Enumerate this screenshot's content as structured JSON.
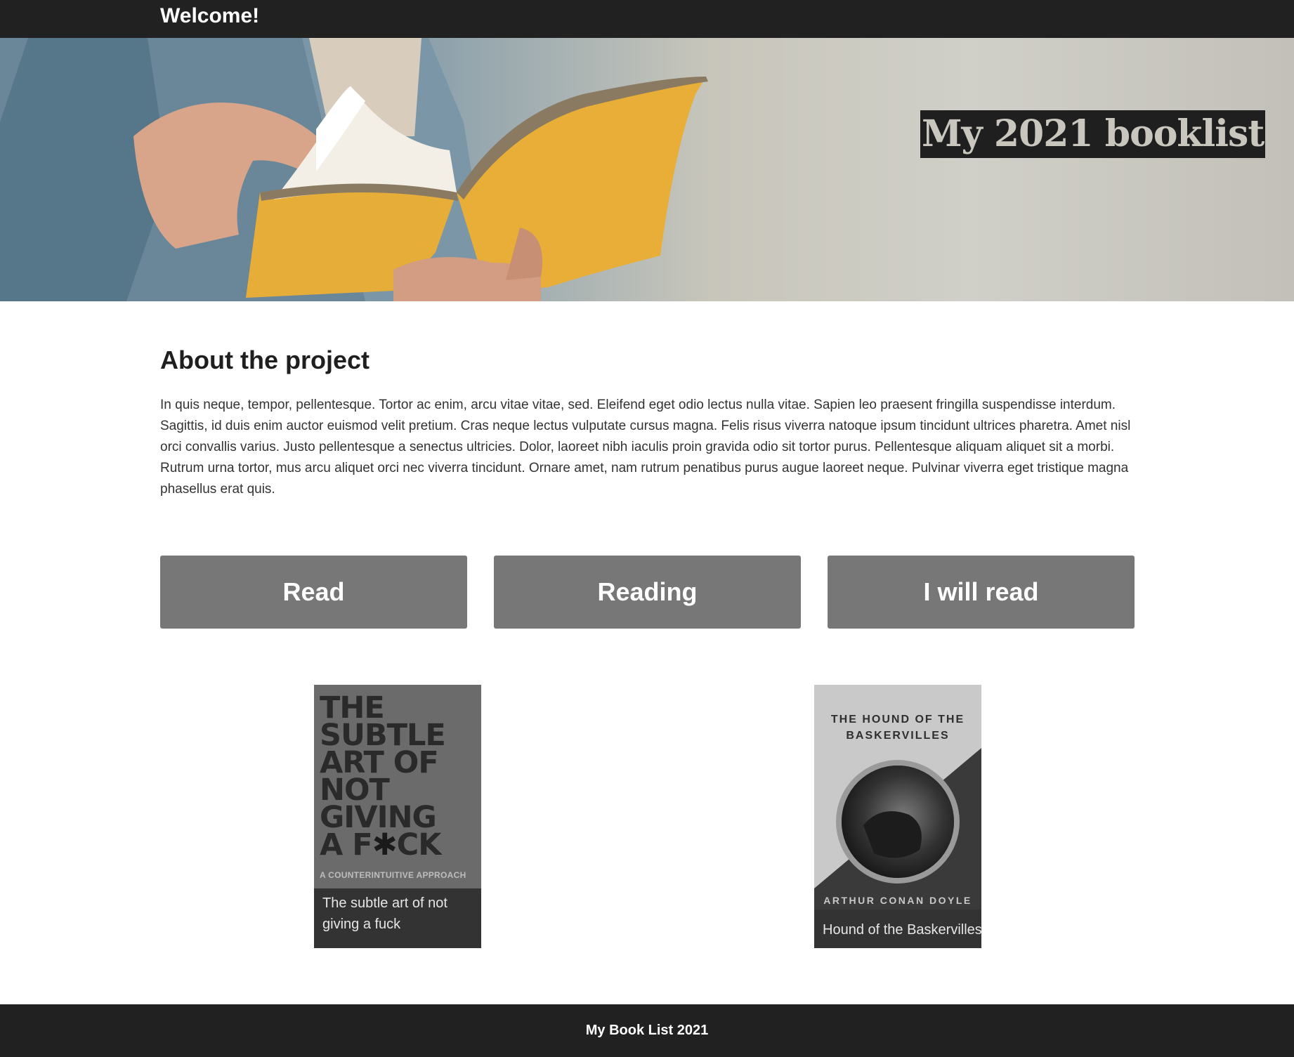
{
  "header": {
    "welcome": "Welcome!"
  },
  "hero": {
    "title": "My 2021 booklist"
  },
  "about": {
    "heading": "About the project",
    "body": "In quis neque, tempor, pellentesque. Tortor ac enim, arcu vitae vitae, sed. Eleifend eget odio lectus nulla vitae. Sapien leo praesent fringilla suspendisse interdum. Sagittis, id duis enim auctor euismod velit pretium. Cras neque lectus vulputate cursus magna. Felis risus viverra natoque ipsum tincidunt ultrices pharetra. Amet nisl orci convallis varius. Justo pellentesque a senectus ultricies. Dolor, laoreet nibh iaculis proin gravida odio sit tortor purus. Pellentesque aliquam aliquet sit a morbi. Rutrum urna tortor, mus arcu aliquet orci nec viverra tincidunt. Ornare amet, nam rutrum penatibus purus augue laoreet neque. Pulvinar viverra eget tristique magna phasellus erat quis."
  },
  "tabs": [
    {
      "label": "Read"
    },
    {
      "label": "Reading"
    },
    {
      "label": "I will read"
    }
  ],
  "books": [
    {
      "title": "The subtle art of not giving a fuck",
      "cover_text": "THE SUBTLE ART OF NOT GIVING A F*CK",
      "cover_subtitle": "A COUNTERINTUITIVE APPROACH"
    },
    {
      "title": "Hound of the Baskervilles",
      "cover_text": "THE HOUND OF THE BASKERVILLES",
      "cover_author": "ARTHUR CONAN DOYLE"
    }
  ],
  "footer": {
    "text": "My Book List 2021"
  },
  "colors": {
    "bar": "#212121",
    "tab": "#777777",
    "caption": "#333333",
    "book_yellow": "#e6ad38"
  }
}
